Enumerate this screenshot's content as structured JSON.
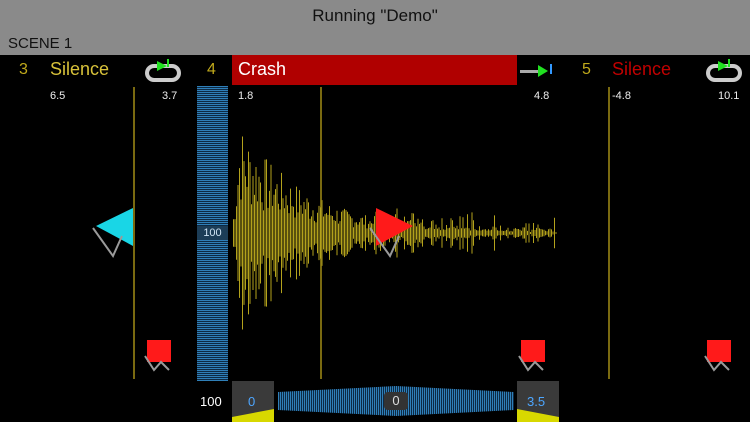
{
  "window": {
    "title": "Running \"Demo\""
  },
  "scene": {
    "label": "SCENE 1"
  },
  "lanes": [
    {
      "number": "3",
      "name": "Silence",
      "left_value": "6.5",
      "right_value": "3.7"
    },
    {
      "number": "4",
      "name": "Crash",
      "left_value": "1.8",
      "right_value": "4.8"
    },
    {
      "number": "5",
      "name": "Silence",
      "left_value": "-4.8",
      "right_value": "10.1"
    }
  ],
  "meter": {
    "center_value": "100",
    "bottom_value": "100"
  },
  "transport": {
    "left_value": "0",
    "center_value": "0",
    "right_value": "3.5"
  },
  "colors": {
    "yellow": "#d8c23a",
    "red": "#c00000",
    "cyan": "#19d6e6",
    "blue": "#2f7fb8"
  }
}
